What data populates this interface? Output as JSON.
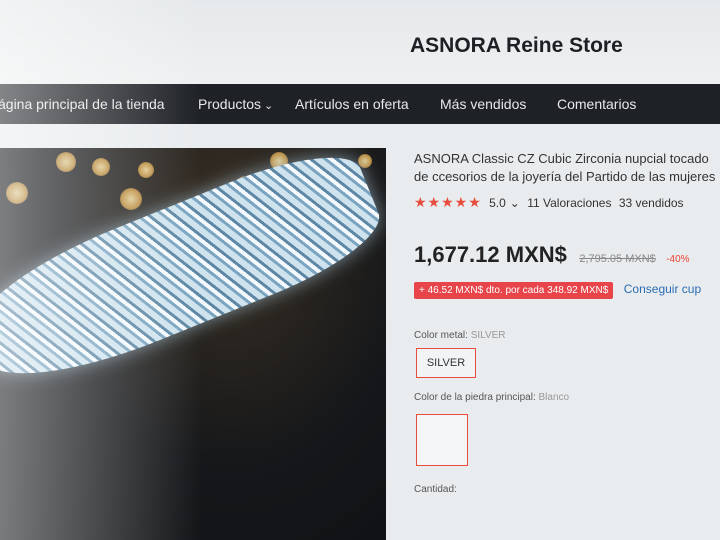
{
  "store": {
    "name": "ASNORA Reine Store"
  },
  "nav": {
    "items": [
      {
        "label": "ágina principal de la tienda"
      },
      {
        "label": "Productos"
      },
      {
        "label": "Artículos en oferta"
      },
      {
        "label": "Más vendidos"
      },
      {
        "label": "Comentarios"
      }
    ]
  },
  "product": {
    "title": "ASNORA Classic CZ Cubic Zirconia nupcial tocado de ccesorios de la joyería del Partido de las mujeres",
    "stars": "★★★★★",
    "rating": "5.0",
    "reviews": "11 Valoraciones",
    "sold": "33 vendidos",
    "price": "1,677.12 MXN$",
    "old_price": "2,795.05 MXN$",
    "discount": "-40%",
    "coupon": "+ 46.52 MXN$ dto. por cada 348.92 MXN$",
    "coupon_link": "Conseguir cup",
    "metal_label": "Color metal:",
    "metal_value": "SILVER",
    "metal_option": "SILVER",
    "stone_label": "Color de la piedra principal:",
    "stone_value": "Blanco",
    "quantity_label": "Cantidad:"
  },
  "colors": {
    "accent": "#e84c3d",
    "nav_bg": "#1e2126",
    "link": "#2b6cb3"
  }
}
